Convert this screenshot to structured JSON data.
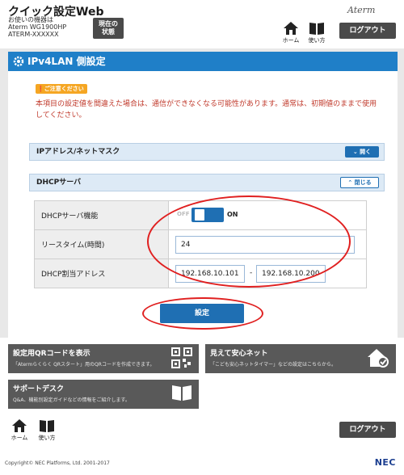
{
  "header": {
    "app_title": "クイック設定Web",
    "device_line1": "お使いの機器は",
    "device_line2": "Aterm WG1900HP",
    "device_line3": "ATERM-XXXXXX",
    "status_button": "現在の\n状態",
    "brand": "Aterm",
    "home_label": "ホーム",
    "help_label": "使い方",
    "logout_label": "ログアウト"
  },
  "page": {
    "title": "IPv4LAN 側設定",
    "notice_badge": "ご注意ください",
    "notice_text": "本項目の設定値を間違えた場合は、通信ができなくなる可能性があります。通常は、初期値のままで使用してください。"
  },
  "sections": {
    "ip_mask": {
      "label": "IPアドレス/ネットマスク",
      "toggle": "開く"
    },
    "dhcp": {
      "label": "DHCPサーバ",
      "toggle": "閉じる"
    }
  },
  "form": {
    "dhcp_function": {
      "label": "DHCPサーバ機能",
      "off_label": "OFF",
      "on_label": "ON",
      "state": "on"
    },
    "lease_time": {
      "label": "リースタイム(時間)",
      "value": "24"
    },
    "dhcp_range": {
      "label": "DHCP割当アドレス",
      "start": "192.168.10.101",
      "separator": "-",
      "end": "192.168.10.200"
    }
  },
  "submit_label": "設定",
  "tiles": {
    "qr": {
      "title": "設定用QRコードを表示",
      "desc": "「Atermらくらく QRスタート」用のQRコードを作成できます。",
      "icon": "qr-code-icon"
    },
    "safe": {
      "title": "見えて安心ネット",
      "desc": "「こども安心ネットタイマー」などの設定はこちらから。",
      "icon": "house-shield-icon"
    },
    "support": {
      "title": "サポートデスク",
      "desc": "Q&A、機能別設定ガイドなどの情報をご紹介します。",
      "icon": "book-icon"
    }
  },
  "footer": {
    "home_label": "ホーム",
    "help_label": "使い方",
    "logout_label": "ログアウト",
    "copyright": "Copyright© NEC Platforms, Ltd. 2001-2017",
    "nec_logo": "NEC"
  },
  "colors": {
    "accent_blue": "#1f7fc8",
    "notice_red": "#c0392b",
    "annotation_red": "#e02020",
    "tile_gray": "#595959"
  }
}
